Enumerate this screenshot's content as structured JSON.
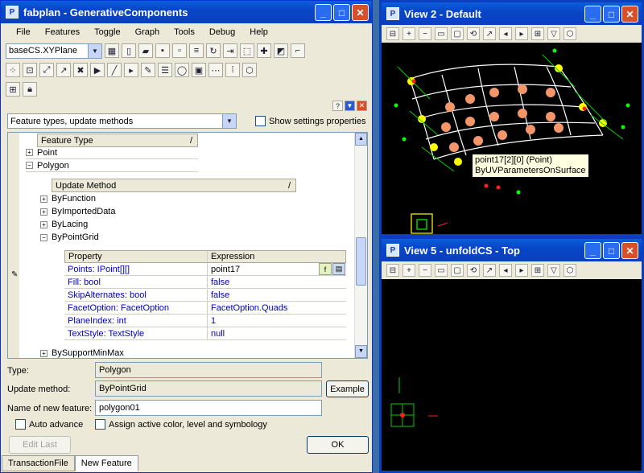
{
  "main_window": {
    "title": "fabplan - GenerativeComponents",
    "menu": [
      "File",
      "Features",
      "Toggle",
      "Graph",
      "Tools",
      "Debug",
      "Help"
    ],
    "coord_system": "baseCS.XYPlane",
    "panel_dropdown": "Feature types, update methods",
    "show_settings_label": "Show settings properties",
    "tree": {
      "feature_type_header": "Feature Type",
      "items": [
        "Point",
        "Polygon"
      ],
      "update_method_header": "Update Method",
      "methods": [
        "ByFunction",
        "ByImportedData",
        "ByLacing",
        "ByPointGrid"
      ],
      "last_method": "BySupportMinMax",
      "property_header": "Property",
      "expression_header": "Expression",
      "properties": [
        {
          "name": "Points: IPoint[][]",
          "value": "point17"
        },
        {
          "name": "Fill: bool",
          "value": "false"
        },
        {
          "name": "SkipAlternates: bool",
          "value": "false"
        },
        {
          "name": "FacetOption: FacetOption",
          "value": "FacetOption.Quads"
        },
        {
          "name": "PlaneIndex: int",
          "value": "1"
        },
        {
          "name": "TextStyle: TextStyle",
          "value": "null"
        }
      ]
    },
    "type_label": "Type:",
    "type_value": "Polygon",
    "update_label": "Update method:",
    "update_value": "ByPointGrid",
    "example_button": "Example",
    "name_label": "Name of new feature:",
    "name_value": "polygon01",
    "auto_advance_label": "Auto advance",
    "assign_label": "Assign active color, level and symbology",
    "edit_last_button": "Edit Last",
    "ok_button": "OK",
    "tabs": [
      "TransactionFile",
      "New Feature"
    ]
  },
  "view2": {
    "title": "View 2 - Default",
    "tooltip_line1": "point17[2][0] (Point)",
    "tooltip_line2": "ByUVParametersOnSurface"
  },
  "view5": {
    "title": "View 5 - unfoldCS - Top"
  }
}
